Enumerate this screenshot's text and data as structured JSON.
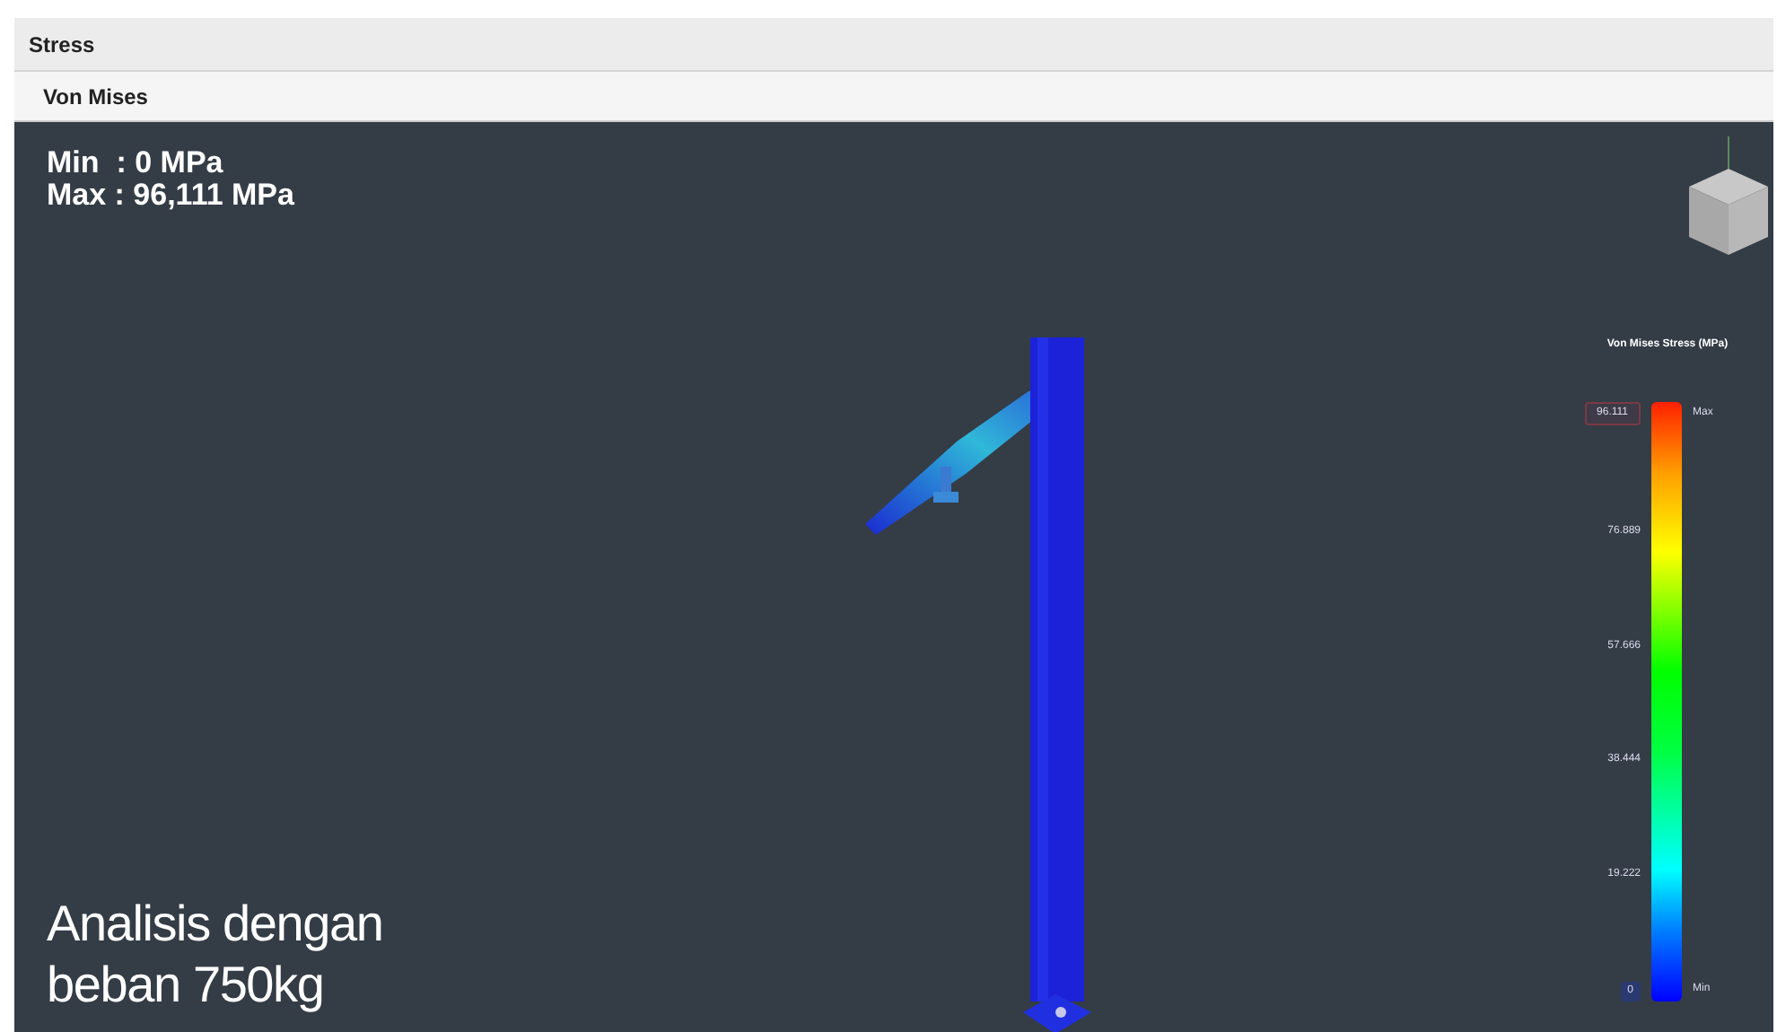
{
  "header": {
    "title": "Stress"
  },
  "subheader": {
    "title": "Von Mises"
  },
  "viewport": {
    "min_label": "Min  : 0 MPa",
    "max_label": "Max : 96,111 MPa",
    "caption": "Analisis dengan beban 750kg"
  },
  "legend": {
    "title": "Von Mises Stress (MPa)",
    "max_value": "96.111",
    "ticks": [
      "76.889",
      "57.666",
      "38.444",
      "19.222"
    ],
    "min_value": "0",
    "max_tag": "Max",
    "min_tag": "Min"
  }
}
